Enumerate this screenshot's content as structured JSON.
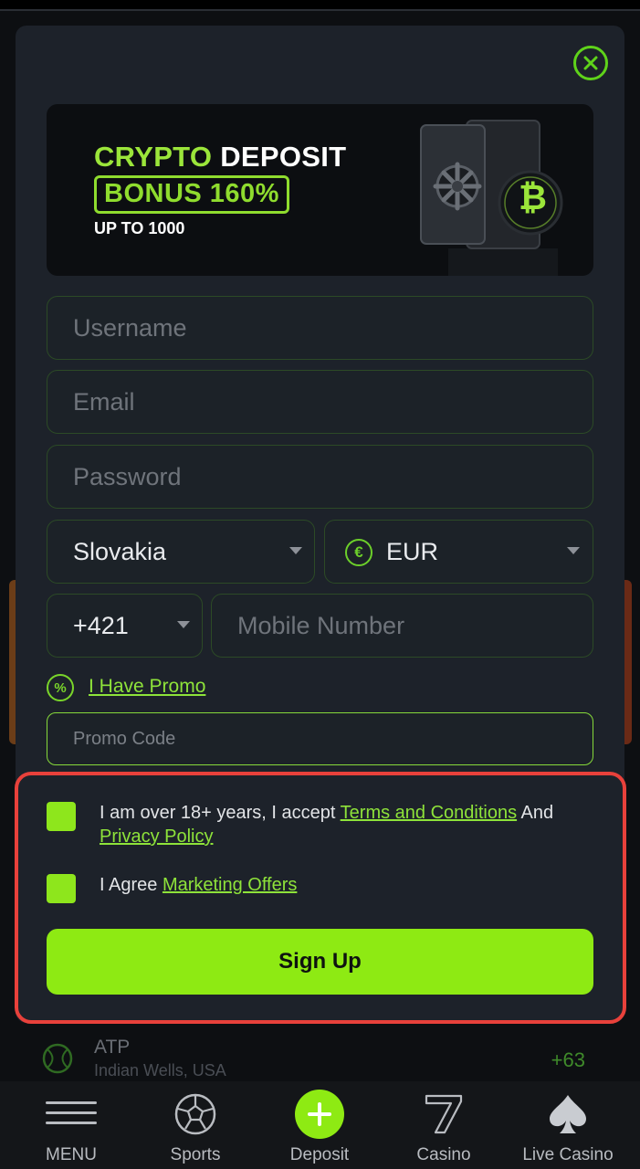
{
  "banner": {
    "line1_green": "CRYPTO",
    "line1_white": "DEPOSIT",
    "bonus": "BONUS 160%",
    "subline": "UP TO 1000",
    "coin_symbol": "₿"
  },
  "form": {
    "username_placeholder": "Username",
    "email_placeholder": "Email",
    "password_placeholder": "Password",
    "country_value": "Slovakia",
    "currency_value": "EUR",
    "currency_symbol": "€",
    "phone_code": "+421",
    "mobile_placeholder": "Mobile Number",
    "promo_link": "I Have Promo",
    "promo_icon_symbol": "%",
    "promo_placeholder": "Promo Code"
  },
  "consent": {
    "age_text": "I am over 18+ years, I accept ",
    "terms_link": "Terms and Conditions",
    "and_text": " And",
    "privacy_link": "Privacy Policy",
    "marketing_text": "I Agree ",
    "marketing_link": "Marketing Offers",
    "checked_age": true,
    "checked_marketing": true
  },
  "signup_label": "Sign Up",
  "background_match": {
    "league": "ATP",
    "location": "Indian Wells, USA",
    "odds": "+63"
  },
  "nav": {
    "items": [
      {
        "label": "MENU",
        "icon": "hamburger-icon"
      },
      {
        "label": "Sports",
        "icon": "soccer-ball-icon"
      },
      {
        "label": "Deposit",
        "icon": "plus-icon"
      },
      {
        "label": "Casino",
        "icon": "seven-icon"
      },
      {
        "label": "Live Casino",
        "icon": "spade-icon"
      }
    ]
  },
  "colors": {
    "accent": "#8eea13",
    "modal_bg": "#1d222a",
    "highlight": "#e8413b"
  }
}
